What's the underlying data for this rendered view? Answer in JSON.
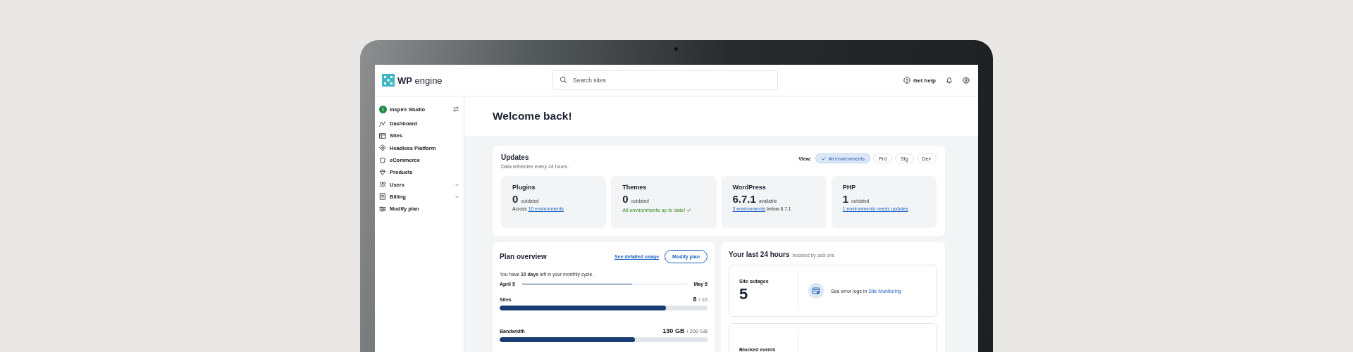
{
  "header": {
    "logo": "WP engine",
    "search": {
      "placeholder": "Search sites"
    },
    "help": "Get help"
  },
  "sidebar": {
    "account": {
      "initial": "I",
      "name": "Inspire Studio"
    },
    "items": [
      {
        "label": "Dashboard"
      },
      {
        "label": "Sites"
      },
      {
        "label": "Headless Platform"
      },
      {
        "label": "eCommerce"
      },
      {
        "label": "Products"
      },
      {
        "label": "Users",
        "expanded": false
      },
      {
        "label": "Billing",
        "expanded": false
      },
      {
        "label": "Modify plan"
      }
    ]
  },
  "welcome": "Welcome back!",
  "updates": {
    "title": "Updates",
    "subtitle": "Data refreshes every 24 hours.",
    "view_label": "View:",
    "filters": [
      {
        "label": "All environments",
        "selected": true
      },
      {
        "label": "Prd",
        "selected": false
      },
      {
        "label": "Stg",
        "selected": false
      },
      {
        "label": "Dev",
        "selected": false
      }
    ],
    "stats": [
      {
        "title": "Plugins",
        "value": "0",
        "unit": "outdated",
        "kind": "link",
        "before": "Across",
        "link": "10 environments"
      },
      {
        "title": "Themes",
        "value": "0",
        "unit": "outdated",
        "kind": "ok",
        "note": "All environments up to date!"
      },
      {
        "title": "WordPress",
        "value": "6.7.1",
        "unit": "available",
        "kind": "link",
        "link": "3 environments",
        "after": "below 6.7.1"
      },
      {
        "title": "PHP",
        "value": "1",
        "unit": "outdated",
        "kind": "link",
        "link": "1 environments needs updates"
      }
    ]
  },
  "plan": {
    "title": "Plan overview",
    "usage_link": "See detailed usage",
    "modify_button": "Modify plan",
    "cycle_text": "You have **10 days** left in your monthly cycle.",
    "cycle": {
      "start": "April 5",
      "end": "May 5",
      "level": 0.67
    },
    "meters": [
      {
        "label": "Sites",
        "used": "8",
        "limit": "/ 10",
        "level": 0.8
      },
      {
        "label": "Bandwidth",
        "used": "130 GB",
        "limit": "/ 200 GB",
        "level": 0.65
      }
    ]
  },
  "last24": {
    "title": "Your last 24 hours",
    "subtitle": "boosted by add-ons",
    "cards": [
      {
        "label": "Site outages",
        "value": "5",
        "text": "See error logs in",
        "link": "Site Monitoring"
      },
      {
        "label": "Blocked events"
      }
    ]
  }
}
